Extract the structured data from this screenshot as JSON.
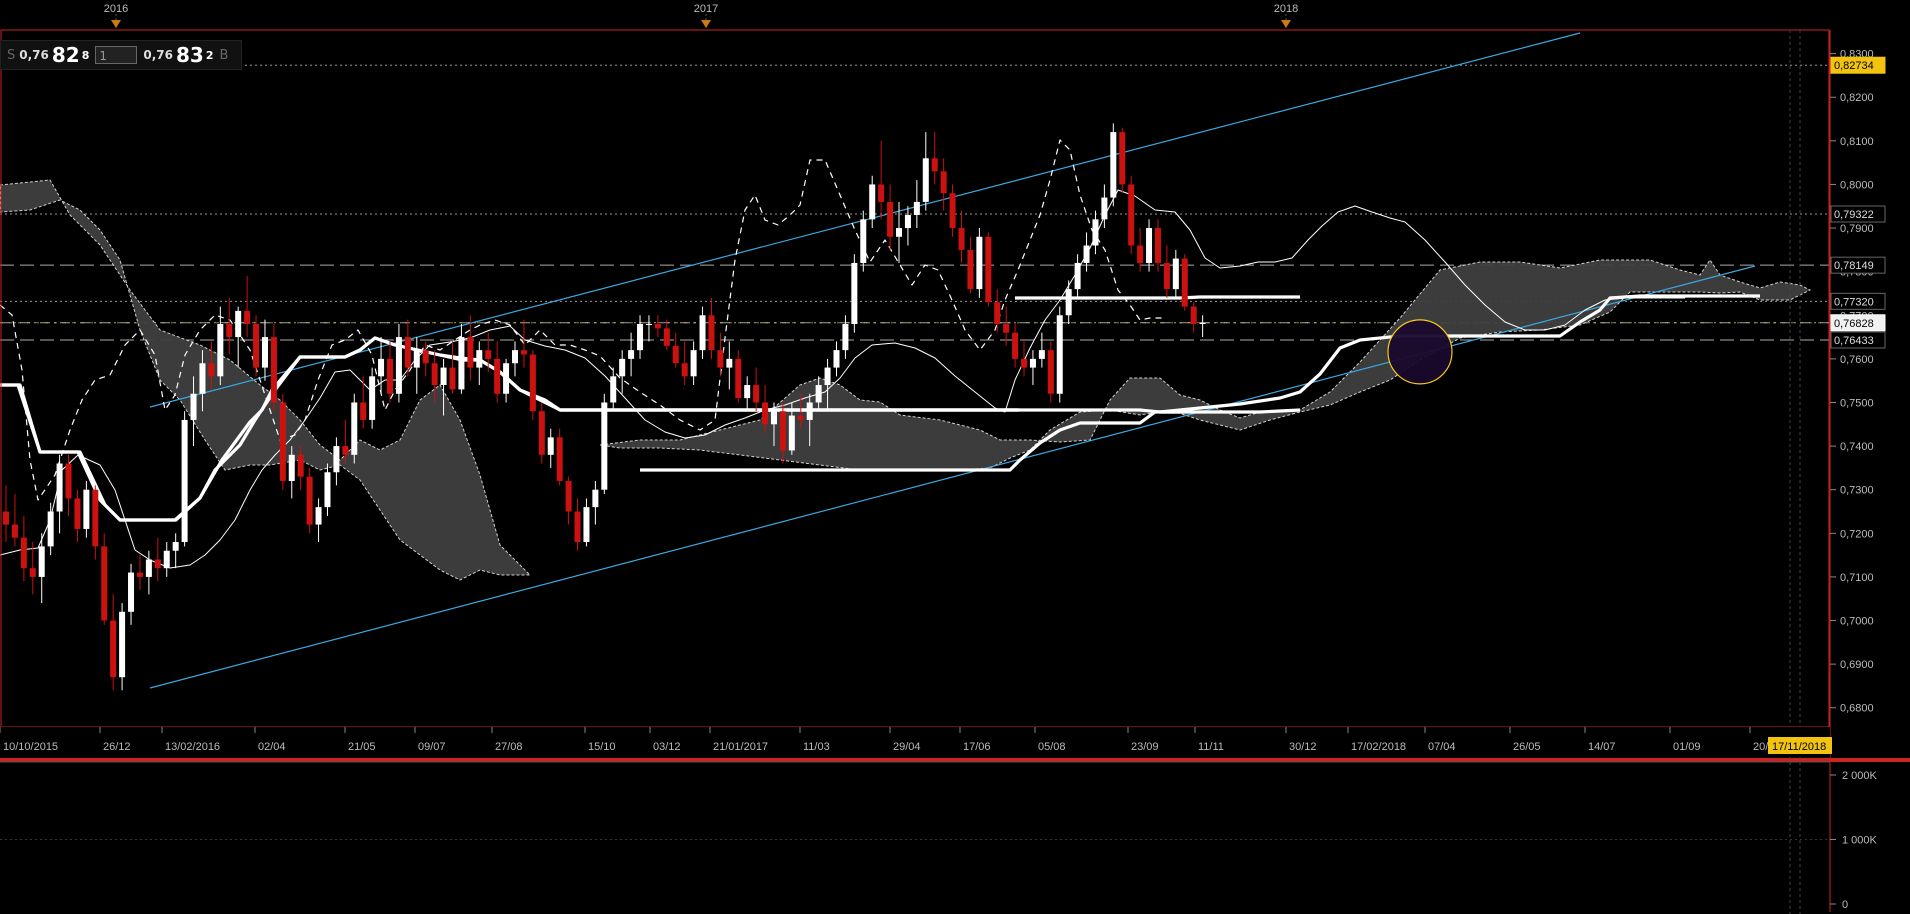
{
  "quote": {
    "sell_label": "S",
    "sell_prefix": "0,76",
    "sell_big": "82",
    "sell_sup": "8",
    "qty": "1",
    "buy_prefix": "0,76",
    "buy_big": "83",
    "buy_sup": "2",
    "buy_label": "B"
  },
  "chart_data": {
    "type": "candlestick",
    "years": [
      "2016",
      "2017",
      "2018"
    ],
    "x_tick_labels": [
      "10/10/2015",
      "26/12",
      "13/02/2016",
      "02/04",
      "21/05",
      "09/07",
      "27/08",
      "15/10",
      "03/12",
      "21/01/2017",
      "11/03",
      "29/04",
      "17/06",
      "05/08",
      "23/09",
      "11/11",
      "30/12",
      "17/02/2018",
      "07/04",
      "26/05",
      "14/07",
      "01/09",
      "20/10"
    ],
    "x_current_label": "17/11/2018",
    "y_ticks": [
      "0,8300",
      "0,8200",
      "0,8100",
      "0,8000",
      "0,7900",
      "0,7800",
      "0,7700",
      "0,7600",
      "0,7500",
      "0,7400",
      "0,7300",
      "0,7200",
      "0,7100",
      "0,7000",
      "0,6900",
      "0,6800"
    ],
    "ylim": [
      0.6765,
      0.8345
    ],
    "price_markers": [
      {
        "value": "0,82734",
        "price": 0.82734,
        "style": "dotted",
        "highlight": "yellow"
      },
      {
        "value": "0,79322",
        "price": 0.79322,
        "style": "dotted"
      },
      {
        "value": "0,78149",
        "price": 0.78149,
        "style": "dashed"
      },
      {
        "value": "0,77320",
        "price": 0.7732,
        "style": "dotted"
      },
      {
        "value": "0,76828",
        "price": 0.76828,
        "style": "dotdash",
        "highlight": "white"
      },
      {
        "value": "0,76433",
        "price": 0.76433,
        "style": "dashed"
      }
    ],
    "volume_ticks": [
      "2 000K",
      "1 000K",
      "0"
    ],
    "volume_max": 2000,
    "colors": {
      "up": "#ffffff",
      "down": "#cc1111",
      "cloud": "#404040",
      "trend": "#3aa8e0",
      "border": "#cc2222",
      "highlight": "#ffd21e"
    }
  }
}
